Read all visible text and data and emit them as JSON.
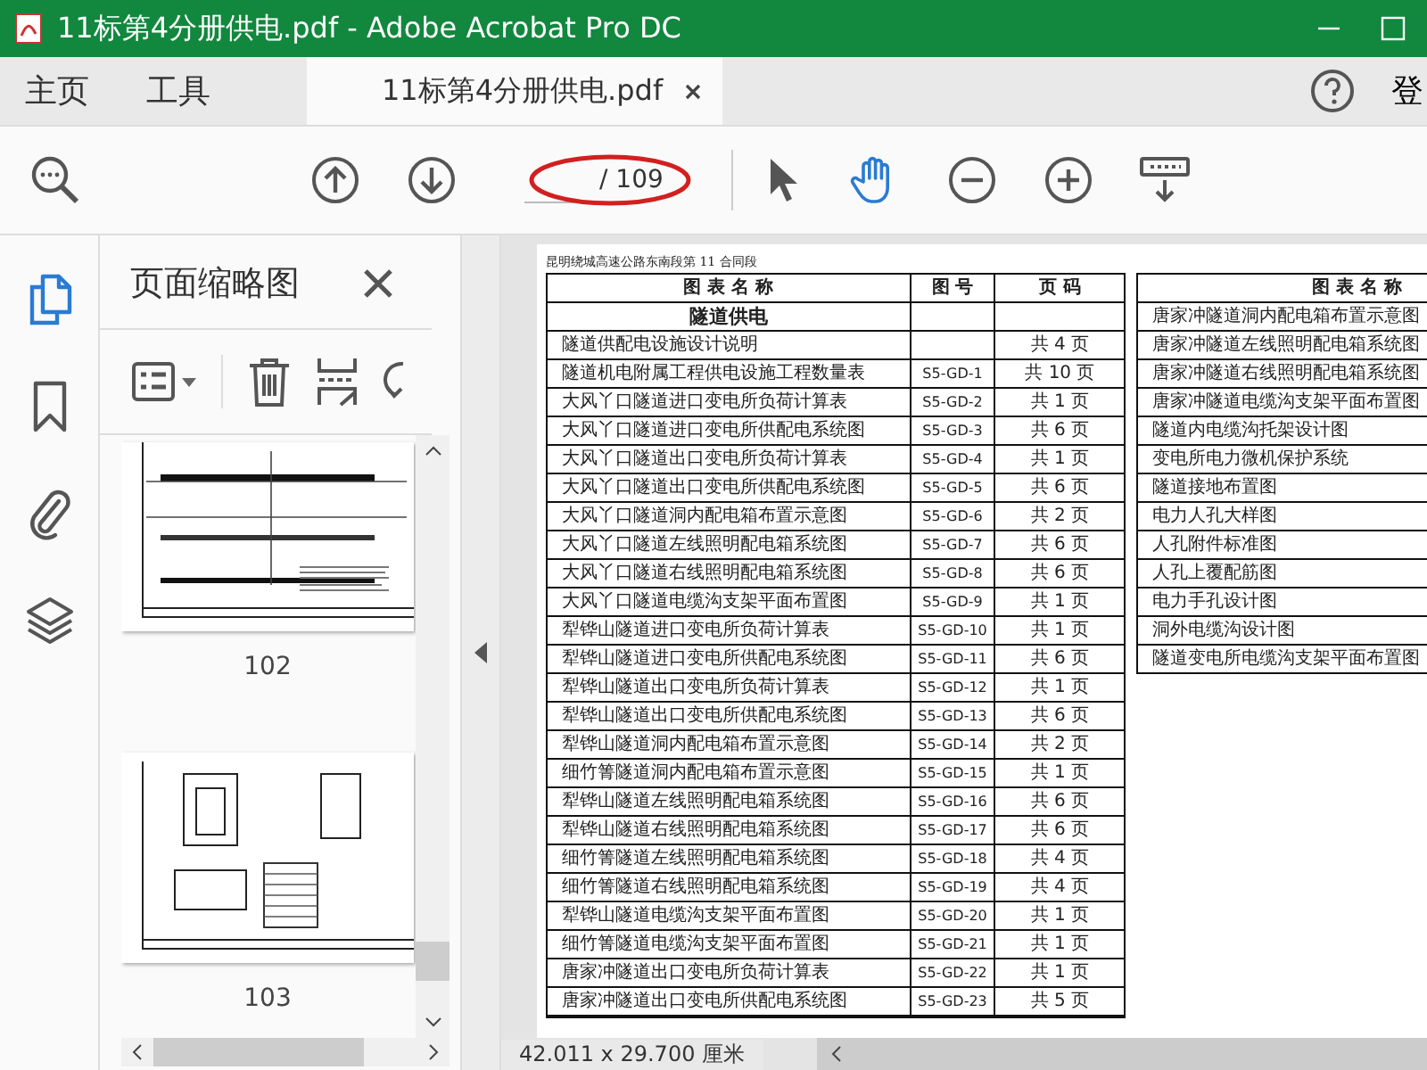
{
  "window": {
    "title": "11标第4分册供电.pdf - Adobe Acrobat Pro DC"
  },
  "tabs": [
    {
      "label": "主页",
      "selected": false,
      "kind": "nav"
    },
    {
      "label": "工具",
      "selected": false,
      "kind": "nav"
    },
    {
      "label": "11标第4分册供电.pdf",
      "selected": true,
      "kind": "document"
    }
  ],
  "sign_in": "登",
  "toolbar": {
    "page_total": "/ 109",
    "tools": [
      {
        "kind": "select",
        "selected": false
      },
      {
        "kind": "hand",
        "selected": true
      }
    ]
  },
  "rail": [
    {
      "kind": "pages",
      "selected": true
    },
    {
      "kind": "bookmark",
      "selected": false
    },
    {
      "kind": "attachment",
      "selected": false
    },
    {
      "kind": "layers",
      "selected": false
    }
  ],
  "sidebar": {
    "title": "页面缩略图",
    "thumbnails": [
      {
        "label": "102",
        "kind": "plan"
      },
      {
        "label": "103",
        "kind": "detail"
      }
    ]
  },
  "document": {
    "header": "昆明绕城高速公路东南段第 11 合同段",
    "left_table": {
      "columns": [
        "图 表 名 称",
        "图 号",
        "页 码"
      ],
      "section": "隧道供电",
      "rows": [
        {
          "name": "隧道供配电设施设计说明",
          "code": "",
          "pages": "共 4 页"
        },
        {
          "name": "隧道机电附属工程供电设施工程数量表",
          "code": "S5-GD-1",
          "pages": "共 10 页"
        },
        {
          "name": "大风丫口隧道进口变电所负荷计算表",
          "code": "S5-GD-2",
          "pages": "共 1 页"
        },
        {
          "name": "大风丫口隧道进口变电所供配电系统图",
          "code": "S5-GD-3",
          "pages": "共 6 页"
        },
        {
          "name": "大风丫口隧道出口变电所负荷计算表",
          "code": "S5-GD-4",
          "pages": "共 1 页"
        },
        {
          "name": "大风丫口隧道出口变电所供配电系统图",
          "code": "S5-GD-5",
          "pages": "共 6 页"
        },
        {
          "name": "大风丫口隧道洞内配电箱布置示意图",
          "code": "S5-GD-6",
          "pages": "共 2 页"
        },
        {
          "name": "大风丫口隧道左线照明配电箱系统图",
          "code": "S5-GD-7",
          "pages": "共 6 页"
        },
        {
          "name": "大风丫口隧道右线照明配电箱系统图",
          "code": "S5-GD-8",
          "pages": "共 6 页"
        },
        {
          "name": "大风丫口隧道电缆沟支架平面布置图",
          "code": "S5-GD-9",
          "pages": "共 1 页"
        },
        {
          "name": "犁铧山隧道进口变电所负荷计算表",
          "code": "S5-GD-10",
          "pages": "共 1 页"
        },
        {
          "name": "犁铧山隧道进口变电所供配电系统图",
          "code": "S5-GD-11",
          "pages": "共 6 页"
        },
        {
          "name": "犁铧山隧道出口变电所负荷计算表",
          "code": "S5-GD-12",
          "pages": "共 1 页"
        },
        {
          "name": "犁铧山隧道出口变电所供配电系统图",
          "code": "S5-GD-13",
          "pages": "共 6 页"
        },
        {
          "name": "犁铧山隧道洞内配电箱布置示意图",
          "code": "S5-GD-14",
          "pages": "共 2 页"
        },
        {
          "name": "细竹箐隧道洞内配电箱布置示意图",
          "code": "S5-GD-15",
          "pages": "共 1 页"
        },
        {
          "name": "犁铧山隧道左线照明配电箱系统图",
          "code": "S5-GD-16",
          "pages": "共 6 页"
        },
        {
          "name": "犁铧山隧道右线照明配电箱系统图",
          "code": "S5-GD-17",
          "pages": "共 6 页"
        },
        {
          "name": "细竹箐隧道左线照明配电箱系统图",
          "code": "S5-GD-18",
          "pages": "共 4 页"
        },
        {
          "name": "细竹箐隧道右线照明配电箱系统图",
          "code": "S5-GD-19",
          "pages": "共 4 页"
        },
        {
          "name": "犁铧山隧道电缆沟支架平面布置图",
          "code": "S5-GD-20",
          "pages": "共 1 页"
        },
        {
          "name": "细竹箐隧道电缆沟支架平面布置图",
          "code": "S5-GD-21",
          "pages": "共 1 页"
        },
        {
          "name": "唐家冲隧道出口变电所负荷计算表",
          "code": "S5-GD-22",
          "pages": "共 1 页"
        },
        {
          "name": "唐家冲隧道出口变电所供配电系统图",
          "code": "S5-GD-23",
          "pages": "共 5 页"
        }
      ]
    },
    "right_table": {
      "column": "图 表 名 称",
      "rows": [
        "唐家冲隧道洞内配电箱布置示意图",
        "唐家冲隧道左线照明配电箱系统图",
        "唐家冲隧道右线照明配电箱系统图",
        "唐家冲隧道电缆沟支架平面布置图",
        "隧道内电缆沟托架设计图",
        "变电所电力微机保护系统",
        "隧道接地布置图",
        "电力人孔大样图",
        "人孔附件标准图",
        "人孔上覆配筋图",
        "电力手孔设计图",
        "洞外电缆沟设计图",
        "隧道变电所电缆沟支架平面布置图"
      ]
    }
  },
  "status_bar": {
    "size": "42.011 x 29.700 厘米"
  }
}
